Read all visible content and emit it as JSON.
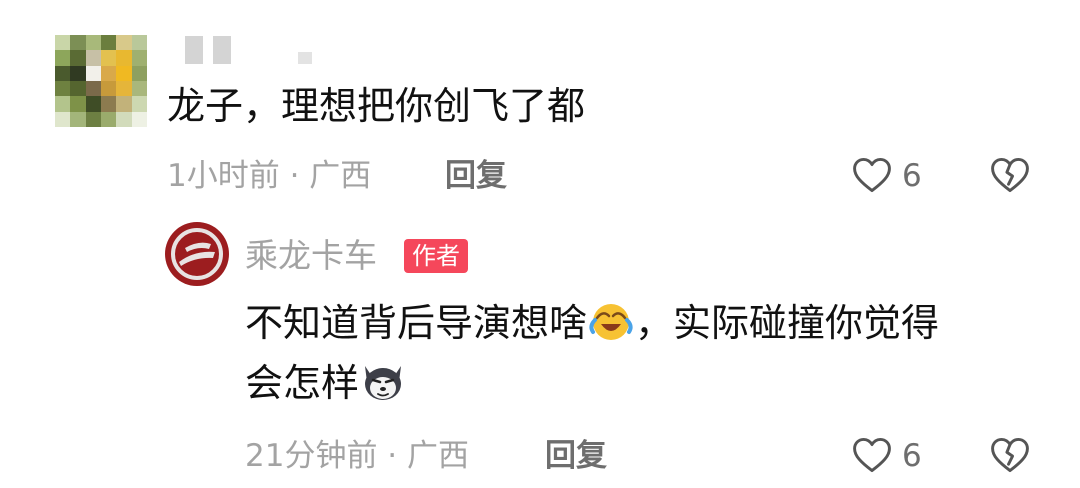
{
  "comments": [
    {
      "text": "龙子，理想把你创飞了都",
      "time_location": "1小时前 · 广西",
      "reply_label": "回复",
      "likes": "6",
      "avatar": "blurred-avatar"
    }
  ],
  "reply": {
    "author": "乘龙卡车",
    "badge": "作者",
    "text_part1": "不知道背后导演想啥",
    "emoji1": "laughing-tears-emoji",
    "text_part2": "，实际碰撞你觉得",
    "text_line2": "会怎样",
    "emoji2": "husky-dog-emoji",
    "time_location": "21分钟前 · 广西",
    "reply_label": "回复",
    "likes": "6"
  },
  "colors": {
    "text": "#111111",
    "meta": "#a3a3a3",
    "badge_bg": "#f5475b",
    "brand_red": "#9c1d1f"
  }
}
